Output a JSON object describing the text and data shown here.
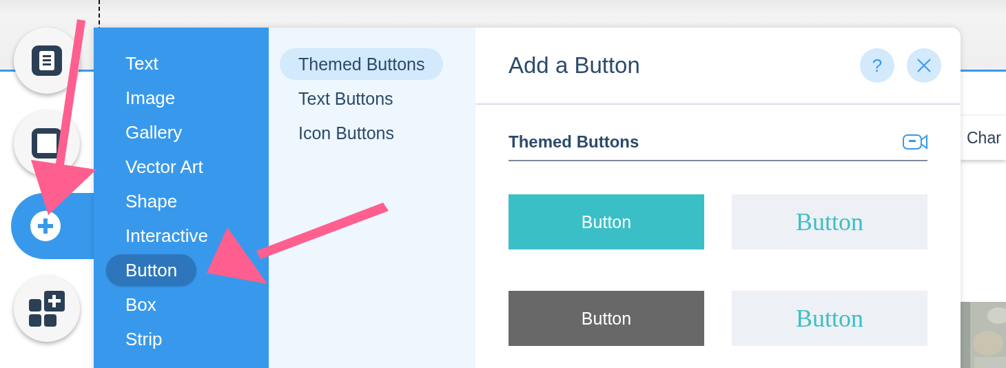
{
  "toolbar": {
    "items": [
      {
        "kind": "pages",
        "selected": false
      },
      {
        "kind": "background",
        "selected": false
      },
      {
        "kind": "add",
        "selected": true
      },
      {
        "kind": "apps",
        "selected": false
      }
    ]
  },
  "side_button": {
    "label": "Char"
  },
  "add_panel": {
    "categories": [
      {
        "label": "Text",
        "selected": false
      },
      {
        "label": "Image",
        "selected": false
      },
      {
        "label": "Gallery",
        "selected": false
      },
      {
        "label": "Vector Art",
        "selected": false
      },
      {
        "label": "Shape",
        "selected": false
      },
      {
        "label": "Interactive",
        "selected": false
      },
      {
        "label": "Button",
        "selected": true
      },
      {
        "label": "Box",
        "selected": false
      },
      {
        "label": "Strip",
        "selected": false
      }
    ],
    "subcategories": [
      {
        "label": "Themed Buttons",
        "selected": true
      },
      {
        "label": "Text Buttons",
        "selected": false
      },
      {
        "label": "Icon Buttons",
        "selected": false
      }
    ],
    "title": "Add a Button",
    "help": "?",
    "section": {
      "title": "Themed Buttons",
      "buttons": [
        {
          "label": "Button",
          "kind": "sans",
          "color": "#3bbfc6"
        },
        {
          "label": "Button",
          "kind": "serif",
          "color": "#edf0f5"
        },
        {
          "label": "Button",
          "kind": "sans",
          "color": "#686868"
        },
        {
          "label": "Button",
          "kind": "serif",
          "color": "#edf0f5"
        }
      ]
    }
  }
}
